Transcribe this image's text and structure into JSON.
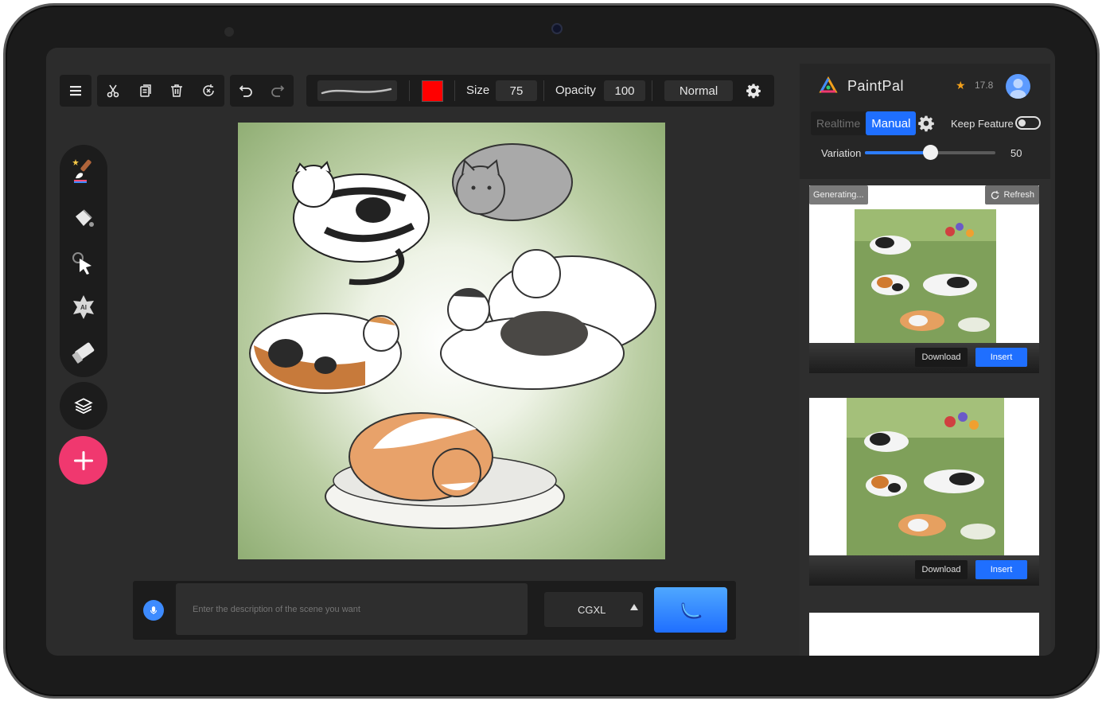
{
  "toolbar": {
    "size_label": "Size",
    "size_value": "75",
    "opacity_label": "Opacity",
    "opacity_value": "100",
    "blend_mode": "Normal",
    "brush_color": "#ff0000"
  },
  "tools": [
    "brush-icon",
    "paint-bucket-icon",
    "select-pointer-icon",
    "ai-icon",
    "eraser-icon"
  ],
  "prompt": {
    "placeholder": "Enter the description of the scene you want",
    "model": "CGXL"
  },
  "panel": {
    "app_name": "PaintPal",
    "score": "17.8",
    "tabs": [
      {
        "label": "Realtime",
        "active": false
      },
      {
        "label": "Manual",
        "active": true
      }
    ],
    "keep_feature_label": "Keep Feature",
    "keep_feature_on": false,
    "variation_label": "Variation",
    "variation_value": "50",
    "variation_fraction": 0.5
  },
  "results": [
    {
      "status": "Generating...",
      "refresh": "Refresh",
      "download": "Download",
      "insert": "Insert"
    },
    {
      "download": "Download",
      "insert": "Insert"
    }
  ],
  "colors": {
    "accent": "#1f6fff",
    "add_button": "#f0386f",
    "canvas_green": "#90ae74"
  }
}
